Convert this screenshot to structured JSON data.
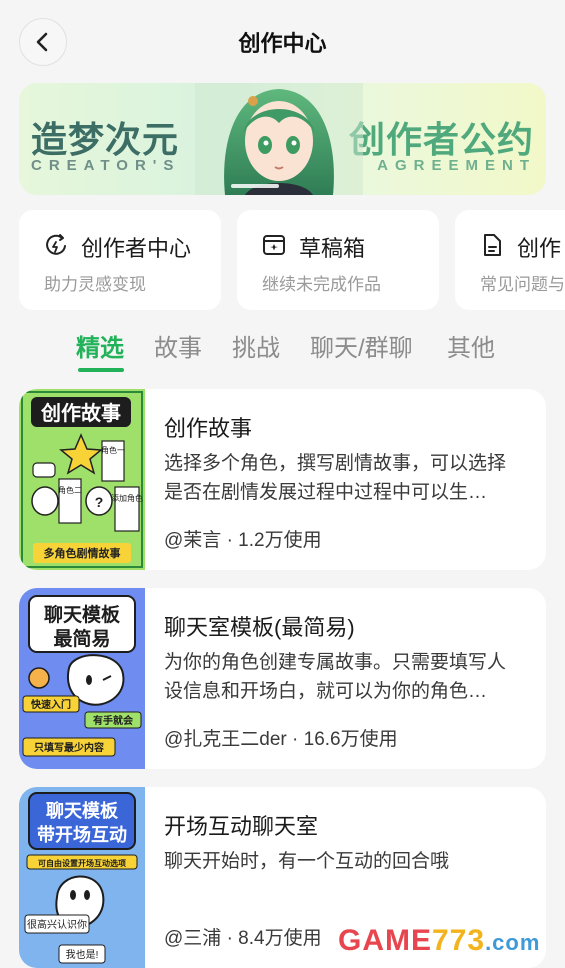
{
  "header": {
    "title": "创作中心",
    "back_icon": "chevron-left-icon"
  },
  "banner": {
    "title_left": "造梦次元",
    "subtitle_left": "CREATOR'S",
    "title_right": "创作者公约",
    "subtitle_right": "AGREEMENT"
  },
  "shortcuts": [
    {
      "icon": "creator-center-icon",
      "title": "创作者中心",
      "desc": "助力灵感变现"
    },
    {
      "icon": "drafts-box-icon",
      "title": "草稿箱",
      "desc": "继续未完成作品"
    },
    {
      "icon": "document-help-icon",
      "title": "创作",
      "desc": "常见问题与"
    }
  ],
  "tabs": [
    "精选",
    "故事",
    "挑战",
    "聊天/群聊",
    "其他"
  ],
  "active_tab": "精选",
  "cards": [
    {
      "title": "创作故事",
      "desc": "选择多个角色，撰写剧情故事，可以选择是否在剧情发展过程中过程中可以生…",
      "meta": "@茉言 · 1.2万使用",
      "thumb": {
        "title": "创作故事",
        "tags": [
          "角色一",
          "角色二",
          "添加角色"
        ],
        "footer": "多角色剧情故事"
      }
    },
    {
      "title": "聊天室模板(最简易)",
      "desc": "为你的角色创建专属故事。只需要填写人设信息和开场白，就可以为你的角色…",
      "meta": "@扎克王二der · 16.6万使用",
      "thumb": {
        "title_line1": "聊天模板",
        "title_line2": "最简易",
        "tags": [
          "快速入门",
          "有手就会",
          "只填写最少内容"
        ]
      }
    },
    {
      "title": "开场互动聊天室",
      "desc": "聊天开始时，有一个互动的回合哦",
      "meta": "@三浦 · 8.4万使用",
      "thumb": {
        "title_line1": "聊天模板",
        "title_line2": "带开场互动",
        "tags": [
          "可自由设置开场互动选项",
          "很高兴认识你",
          "我也是!"
        ]
      }
    }
  ],
  "watermark": {
    "text_a": "GAME",
    "text_b": "773",
    "text_c": ".com"
  },
  "colors": {
    "accent": "#22b35a",
    "background": "#f4f5f4",
    "card": "#ffffff",
    "muted": "#9a9a9a"
  }
}
